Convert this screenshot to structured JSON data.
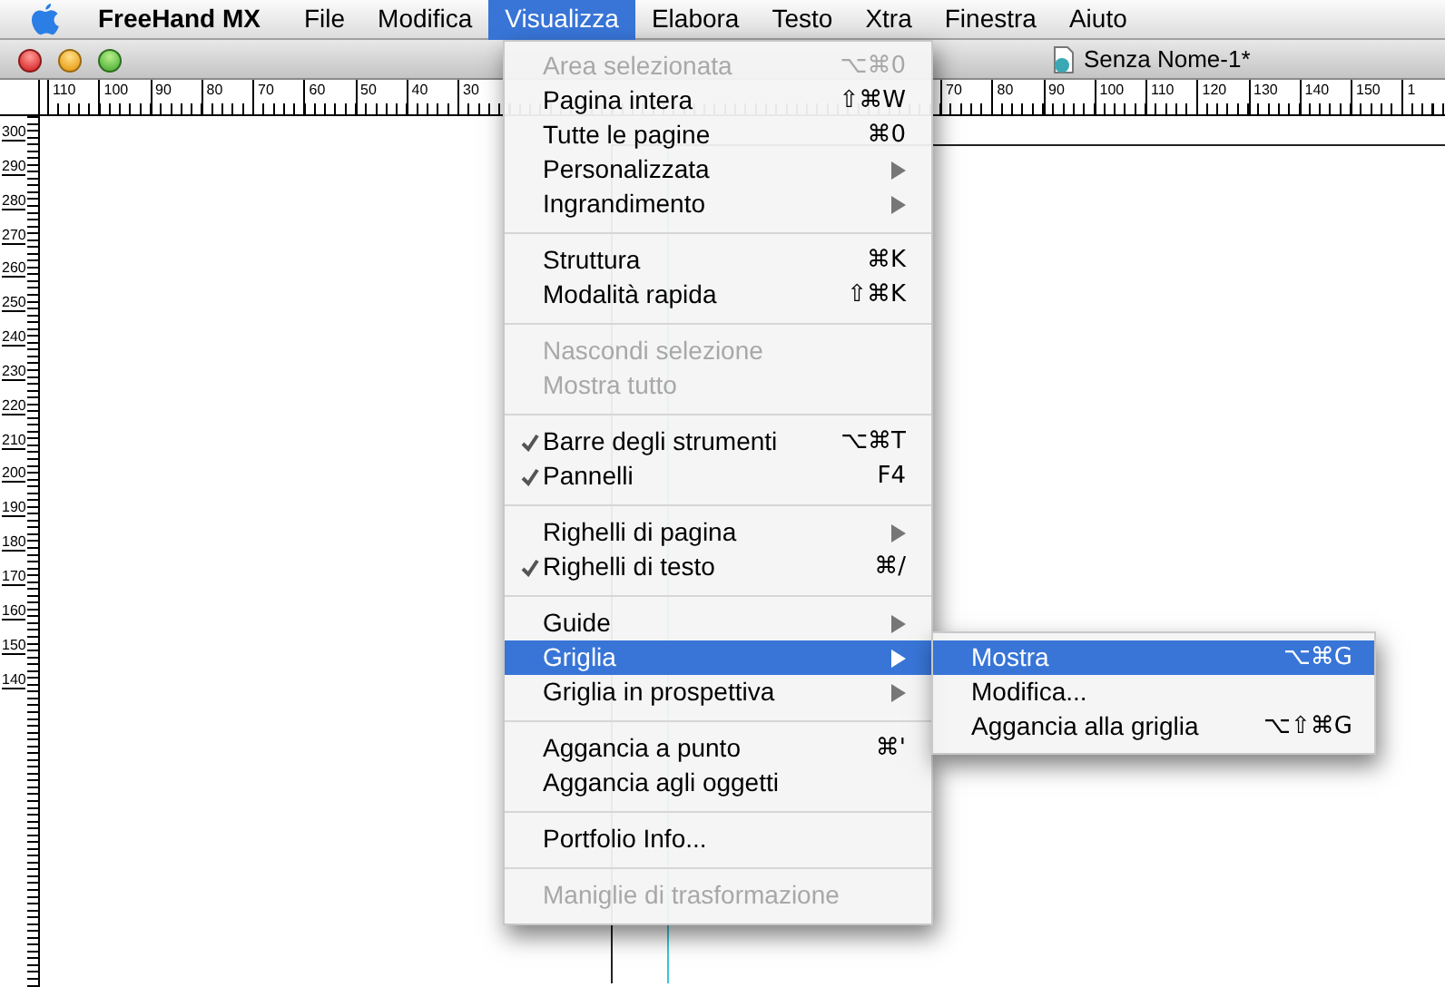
{
  "menubar": {
    "items": [
      {
        "label": "FreeHand MX",
        "kind": "app",
        "selected": false
      },
      {
        "label": "File",
        "kind": "menu",
        "selected": false
      },
      {
        "label": "Modifica",
        "kind": "menu",
        "selected": false
      },
      {
        "label": "Visualizza",
        "kind": "menu",
        "selected": true
      },
      {
        "label": "Elabora",
        "kind": "menu",
        "selected": false
      },
      {
        "label": "Testo",
        "kind": "menu",
        "selected": false
      },
      {
        "label": "Xtra",
        "kind": "menu",
        "selected": false
      },
      {
        "label": "Finestra",
        "kind": "menu",
        "selected": false
      },
      {
        "label": "Aiuto",
        "kind": "menu",
        "selected": false
      }
    ]
  },
  "window": {
    "title": "Senza Nome-1*"
  },
  "rulers": {
    "top_left_labels": [
      "110",
      "100",
      "90",
      "80",
      "70",
      "60",
      "50",
      "40",
      "30"
    ],
    "top_right_labels": [
      "70",
      "80",
      "90",
      "100",
      "110",
      "120",
      "130",
      "140",
      "150",
      "1"
    ],
    "left_labels": [
      "300",
      "290",
      "280",
      "270",
      "260",
      "250",
      "240",
      "230",
      "220",
      "210",
      "200",
      "190",
      "180",
      "170",
      "160",
      "150",
      "140"
    ]
  },
  "menu": {
    "items": [
      {
        "kind": "item",
        "label": "Area selezionata",
        "shortcut": "⌥⌘0",
        "disabled": true,
        "checked": false,
        "submenu": false,
        "selected": false
      },
      {
        "kind": "item",
        "label": "Pagina intera",
        "shortcut": "⇧⌘W",
        "disabled": false,
        "checked": false,
        "submenu": false,
        "selected": false
      },
      {
        "kind": "item",
        "label": "Tutte le pagine",
        "shortcut": "⌘0",
        "disabled": false,
        "checked": false,
        "submenu": false,
        "selected": false
      },
      {
        "kind": "item",
        "label": "Personalizzata",
        "disabled": false,
        "checked": false,
        "submenu": true,
        "selected": false
      },
      {
        "kind": "item",
        "label": "Ingrandimento",
        "disabled": false,
        "checked": false,
        "submenu": true,
        "selected": false
      },
      {
        "kind": "separator"
      },
      {
        "kind": "item",
        "label": "Struttura",
        "shortcut": "⌘K",
        "disabled": false,
        "checked": false,
        "submenu": false,
        "selected": false
      },
      {
        "kind": "item",
        "label": "Modalità rapida",
        "shortcut": "⇧⌘K",
        "disabled": false,
        "checked": false,
        "submenu": false,
        "selected": false
      },
      {
        "kind": "separator"
      },
      {
        "kind": "item",
        "label": "Nascondi selezione",
        "disabled": true,
        "checked": false,
        "submenu": false,
        "selected": false
      },
      {
        "kind": "item",
        "label": "Mostra tutto",
        "disabled": true,
        "checked": false,
        "submenu": false,
        "selected": false
      },
      {
        "kind": "separator"
      },
      {
        "kind": "item",
        "label": "Barre degli strumenti",
        "shortcut": "⌥⌘T",
        "disabled": false,
        "checked": true,
        "submenu": false,
        "selected": false
      },
      {
        "kind": "item",
        "label": "Pannelli",
        "shortcut": "F4",
        "disabled": false,
        "checked": true,
        "submenu": false,
        "selected": false
      },
      {
        "kind": "separator"
      },
      {
        "kind": "item",
        "label": "Righelli di pagina",
        "disabled": false,
        "checked": false,
        "submenu": true,
        "selected": false
      },
      {
        "kind": "item",
        "label": "Righelli di testo",
        "shortcut": "⌘/",
        "disabled": false,
        "checked": true,
        "submenu": false,
        "selected": false
      },
      {
        "kind": "separator"
      },
      {
        "kind": "item",
        "label": "Guide",
        "disabled": false,
        "checked": false,
        "submenu": true,
        "selected": false
      },
      {
        "kind": "item",
        "label": "Griglia",
        "disabled": false,
        "checked": false,
        "submenu": true,
        "selected": true
      },
      {
        "kind": "item",
        "label": "Griglia in prospettiva",
        "disabled": false,
        "checked": false,
        "submenu": true,
        "selected": false
      },
      {
        "kind": "separator"
      },
      {
        "kind": "item",
        "label": "Aggancia a punto",
        "shortcut": "⌘'",
        "disabled": false,
        "checked": false,
        "submenu": false,
        "selected": false
      },
      {
        "kind": "item",
        "label": "Aggancia agli oggetti",
        "disabled": false,
        "checked": false,
        "submenu": false,
        "selected": false
      },
      {
        "kind": "separator"
      },
      {
        "kind": "item",
        "label": "Portfolio Info...",
        "disabled": false,
        "checked": false,
        "submenu": false,
        "selected": false
      },
      {
        "kind": "separator"
      },
      {
        "kind": "item",
        "label": "Maniglie di trasformazione",
        "disabled": true,
        "checked": false,
        "submenu": false,
        "selected": false
      }
    ]
  },
  "submenu": {
    "items": [
      {
        "label": "Mostra",
        "shortcut": "⌥⌘G",
        "selected": true
      },
      {
        "label": "Modifica...",
        "selected": false
      },
      {
        "label": "Aggancia alla griglia",
        "shortcut": "⌥⇧⌘G",
        "selected": false
      }
    ]
  }
}
